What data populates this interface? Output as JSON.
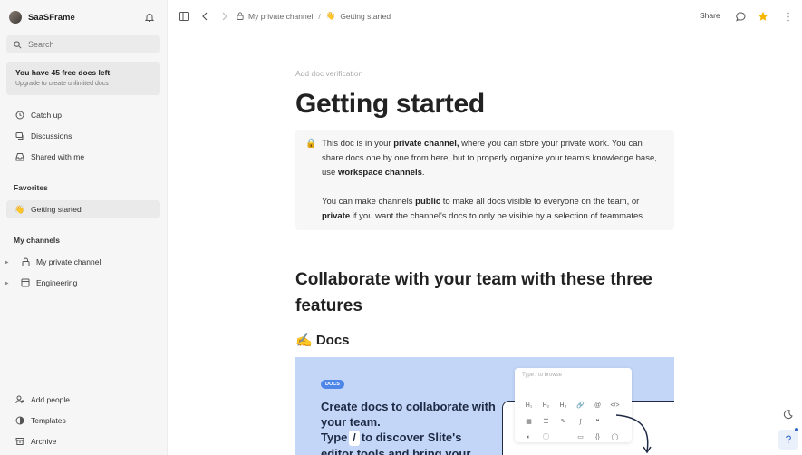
{
  "workspace": {
    "name": "SaaSFrame"
  },
  "search": {
    "label": "Search"
  },
  "promo": {
    "title": "You have 45 free docs left",
    "subtitle": "Upgrade to create unlimited docs"
  },
  "nav": {
    "catch_up": "Catch up",
    "discussions": "Discussions",
    "shared": "Shared with me"
  },
  "favorites": {
    "label": "Favorites",
    "items": [
      {
        "emoji": "👋",
        "label": "Getting started"
      }
    ]
  },
  "channels": {
    "label": "My channels",
    "items": [
      {
        "label": "My private channel"
      },
      {
        "label": "Engineering"
      }
    ]
  },
  "footer": {
    "add_people": "Add people",
    "templates": "Templates",
    "archive": "Archive"
  },
  "topbar": {
    "crumb_channel": "My private channel",
    "crumb_sep": "/",
    "crumb_doc_emoji": "👋",
    "crumb_doc": "Getting started",
    "share": "Share"
  },
  "doc": {
    "verification": "Add doc verification",
    "title": "Getting started",
    "callout": {
      "p1_a": "This doc is in your ",
      "p1_b": "private channel,",
      "p1_c": " where you can store your private work. You can share docs one by one from here, but to properly organize your team's knowledge base, use ",
      "p1_d": "workspace channels",
      "p1_e": ".",
      "p2_a": "You can make channels ",
      "p2_b": "public",
      "p2_c": " to make all docs visible to everyone on the team, or ",
      "p2_d": "private",
      "p2_e": " if you want the channel's docs to only be visible by a selection of teammates."
    },
    "h2": "Collaborate with your team with these three features",
    "h3": "✍️ Docs",
    "banner": {
      "badge": "DOCS",
      "line1": "Create docs to collaborate with your team.",
      "line2_a": "Type",
      "line2_key": "/",
      "line2_b": "to discover Slite's editor tools and bring your",
      "menu_placeholder": "Type / to browse"
    }
  },
  "help": {
    "label": "?"
  },
  "colors": {
    "sidebar_bg": "#f6f6f6",
    "accent": "#f5b800",
    "banner_bg": "#c3d6f7",
    "badge": "#4e86e8"
  }
}
